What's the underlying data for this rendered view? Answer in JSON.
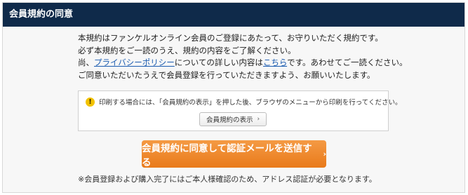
{
  "header": {
    "title": "会員規約の同意"
  },
  "intro": {
    "line1": "本規約はファンケルオンライン会員のご登録にあたって、お守りいただく規約です。",
    "line2": "必ず本規約をご一読のうえ、規約の内容をご了解ください。",
    "line3_prefix": "尚、",
    "privacy_link": "プライバシーポリシー",
    "line3_middle": "についての詳しい内容は",
    "here_link": "こちら",
    "line3_suffix": "です。あわせてご一読ください。",
    "line4": "ご同意いただいたうえで会員登録を行っていただきますよう、お願いいたします。"
  },
  "notice": {
    "icon": "warning-icon",
    "text": "印刷する場合には、「会員規約の表示」を押した後、ブラウザのメニューから印刷を行ってください。",
    "button_label": "会員規約の表示",
    "button_chevron": "›"
  },
  "cta": {
    "label": "会員規約に同意して認証メールを送信する",
    "chevron": "›"
  },
  "footnote": "※会員登録および購入完了にはご本人様確認のため、アドレス認証が必要となります。",
  "colors": {
    "header_bg": "#0f2a4a",
    "cta_bg": "#ee8a2e",
    "link": "#1a5bb0",
    "warning": "#f2c200"
  }
}
